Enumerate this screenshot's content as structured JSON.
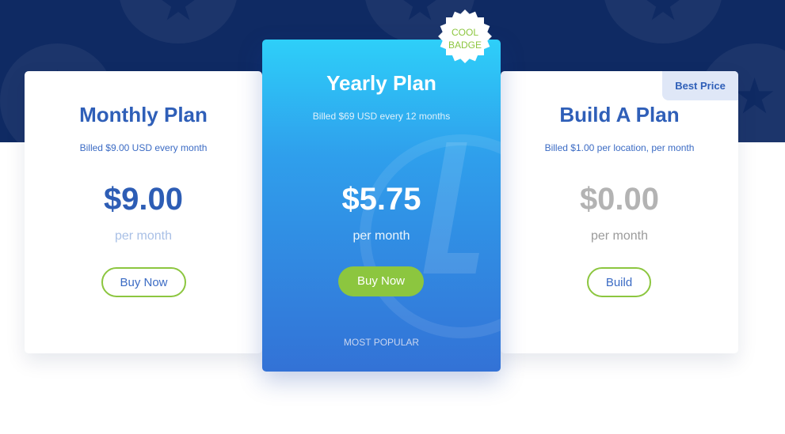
{
  "colors": {
    "hero_background": "#0f2a63",
    "accent_green": "#8cc63f",
    "primary_blue": "#2f5fb8",
    "featured_gradient_top": "#2ecff9",
    "featured_gradient_bottom": "#3372d6"
  },
  "badge": {
    "line1": "COOL",
    "line2": "BADGE"
  },
  "plans": [
    {
      "title": "Monthly Plan",
      "billing": "Billed $9.00 USD every month",
      "price": "$9.00",
      "period": "per month",
      "button_label": "Buy Now"
    },
    {
      "title": "Yearly Plan",
      "billing": "Billed $69 USD every 12 months",
      "price": "$5.75",
      "period": "per month",
      "button_label": "Buy Now",
      "footer": "MOST POPULAR"
    },
    {
      "title": "Build A Plan",
      "billing": "Billed $1.00 per location, per month",
      "price": "$0.00",
      "period": "per month",
      "button_label": "Build",
      "ribbon": "Best Price"
    }
  ],
  "icons": {
    "background_decoration": "star-icon",
    "featured_watermark": "checkmark-icon",
    "badge_shape": "starburst-icon"
  }
}
